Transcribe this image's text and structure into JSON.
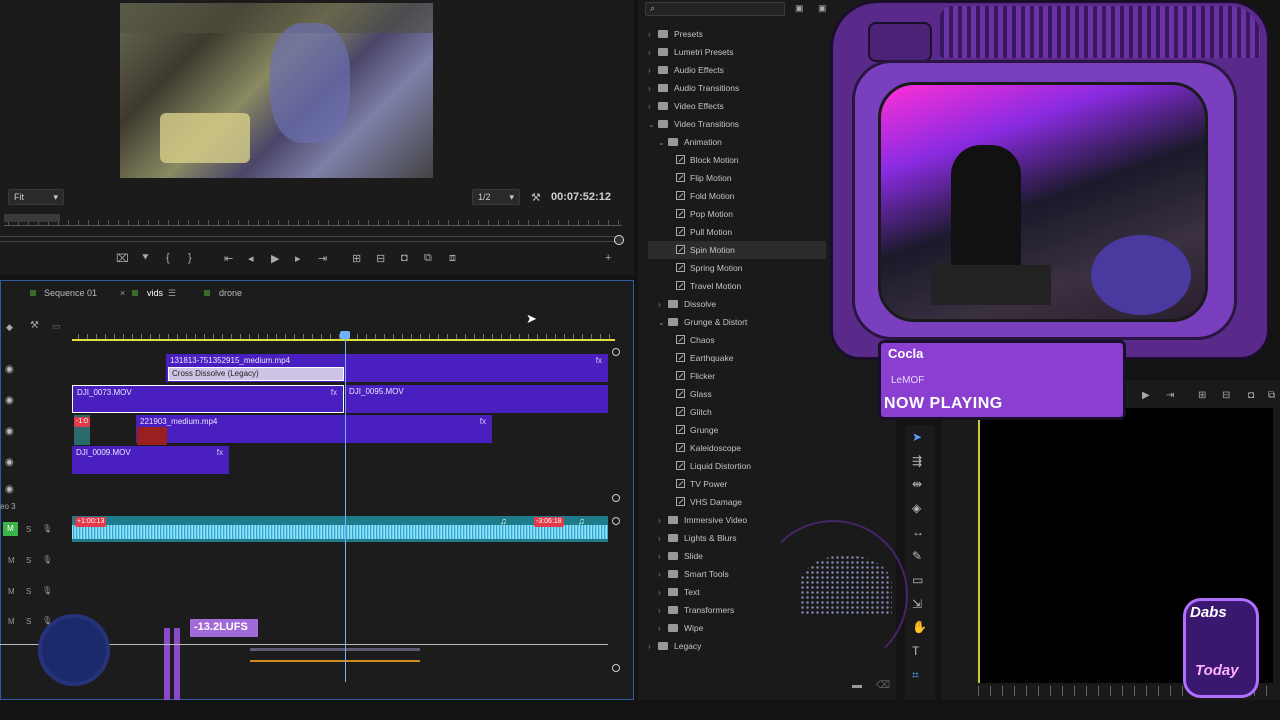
{
  "program_monitor": {
    "fit_label": "Fit",
    "resolution_label": "1/2",
    "timecode": "00:07:52:12"
  },
  "timeline": {
    "tabs": [
      {
        "label": "Sequence 01"
      },
      {
        "label": "vids"
      },
      {
        "label": "drone"
      }
    ],
    "clips": {
      "v3": "131813-751352915_medium.mp4",
      "transition": "Cross Dissolve (Legacy)",
      "v2a": "DJI_0073.MOV",
      "v2b": "DJI_0095.MOV",
      "v1": "221903_medium.mp4",
      "v0": "DJI_0009.MOV",
      "fx": "fx"
    },
    "audio": {
      "badge_left": "+1:00:13",
      "badge_right": "-3:06:18",
      "track_label": "eo 3"
    },
    "track_controls": {
      "m": "M",
      "s": "S"
    },
    "v1_badge": "-1:0",
    "lufs": "-13.2LUFS"
  },
  "effects_panel": {
    "items": [
      {
        "label": "Presets",
        "level": 0,
        "type": "folder",
        "expanded": false
      },
      {
        "label": "Lumetri Presets",
        "level": 0,
        "type": "folder",
        "expanded": false
      },
      {
        "label": "Audio Effects",
        "level": 0,
        "type": "folder",
        "expanded": false
      },
      {
        "label": "Audio Transitions",
        "level": 0,
        "type": "folder",
        "expanded": false
      },
      {
        "label": "Video Effects",
        "level": 0,
        "type": "folder",
        "expanded": false
      },
      {
        "label": "Video Transitions",
        "level": 0,
        "type": "folder",
        "expanded": true
      },
      {
        "label": "Animation",
        "level": 1,
        "type": "folder",
        "expanded": true
      },
      {
        "label": "Block Motion",
        "level": 2,
        "type": "effect"
      },
      {
        "label": "Flip Motion",
        "level": 2,
        "type": "effect"
      },
      {
        "label": "Fold Motion",
        "level": 2,
        "type": "effect"
      },
      {
        "label": "Pop Motion",
        "level": 2,
        "type": "effect"
      },
      {
        "label": "Pull Motion",
        "level": 2,
        "type": "effect"
      },
      {
        "label": "Spin Motion",
        "level": 2,
        "type": "effect",
        "selected": true
      },
      {
        "label": "Spring Motion",
        "level": 2,
        "type": "effect"
      },
      {
        "label": "Travel Motion",
        "level": 2,
        "type": "effect"
      },
      {
        "label": "Dissolve",
        "level": 1,
        "type": "folder",
        "expanded": false
      },
      {
        "label": "Grunge & Distort",
        "level": 1,
        "type": "folder",
        "expanded": true
      },
      {
        "label": "Chaos",
        "level": 2,
        "type": "effect"
      },
      {
        "label": "Earthquake",
        "level": 2,
        "type": "effect"
      },
      {
        "label": "Flicker",
        "level": 2,
        "type": "effect"
      },
      {
        "label": "Glass",
        "level": 2,
        "type": "effect"
      },
      {
        "label": "Glitch",
        "level": 2,
        "type": "effect"
      },
      {
        "label": "Grunge",
        "level": 2,
        "type": "effect"
      },
      {
        "label": "Kaleidoscope",
        "level": 2,
        "type": "effect"
      },
      {
        "label": "Liquid Distortion",
        "level": 2,
        "type": "effect"
      },
      {
        "label": "TV Power",
        "level": 2,
        "type": "effect"
      },
      {
        "label": "VHS Damage",
        "level": 2,
        "type": "effect"
      },
      {
        "label": "Immersive Video",
        "level": 1,
        "type": "folder",
        "expanded": false
      },
      {
        "label": "Lights & Blurs",
        "level": 1,
        "type": "folder",
        "expanded": false
      },
      {
        "label": "Slide",
        "level": 1,
        "type": "folder",
        "expanded": false
      },
      {
        "label": "Smart Tools",
        "level": 1,
        "type": "folder",
        "expanded": false
      },
      {
        "label": "Text",
        "level": 1,
        "type": "folder",
        "expanded": false
      },
      {
        "label": "Transformers",
        "level": 1,
        "type": "folder",
        "expanded": false
      },
      {
        "label": "Wipe",
        "level": 1,
        "type": "folder",
        "expanded": false
      },
      {
        "label": "Legacy",
        "level": 0,
        "type": "folder",
        "expanded": false
      }
    ]
  },
  "overlay": {
    "artist": "Cocla",
    "track": "LeMOF",
    "now_playing": "NOW PLAYING",
    "logo_top": "Dabs",
    "logo_bottom": "Today"
  },
  "icons": {
    "tools": [
      "selection-icon",
      "track-select-icon",
      "ripple-edit-icon",
      "razor-icon",
      "slip-icon",
      "pen-icon",
      "rectangle-icon",
      "hand-icon",
      "type-icon",
      "remix-icon"
    ]
  },
  "colors": {
    "accent_blue": "#2f5ba3",
    "clip_purple": "#4a1fbf",
    "audio_teal": "#1e7c8a",
    "overlay_purple": "#5a2a8a",
    "playhead": "#6fb0ff"
  }
}
